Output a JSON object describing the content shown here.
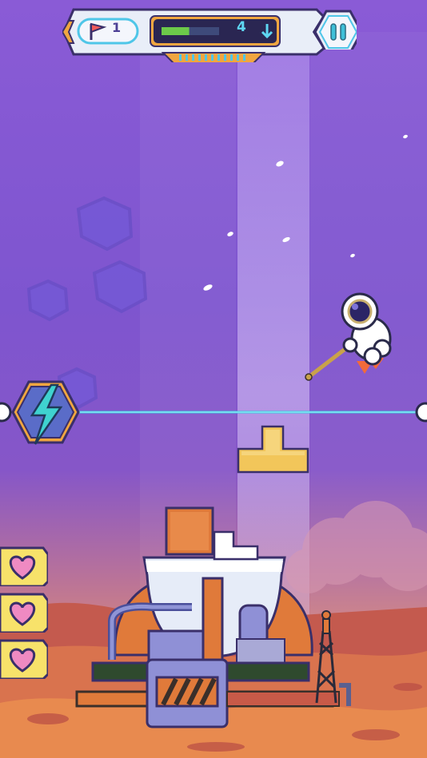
{
  "hud": {
    "flag_count": "1",
    "depth_count": "4",
    "progress": 0.48,
    "flag_icon": "flag-icon",
    "depth_icon": "arrow-down-icon",
    "pause_icon": "pause-icon"
  },
  "lives": {
    "count": 3,
    "icon": "heart-icon"
  },
  "power_icon": "lightning-bolt-icon",
  "colors": {
    "sky": "#7e55cf",
    "block_orange": "#e07a3a",
    "tpiece_yellow": "#f2c65a",
    "laser": "#34c8e0",
    "heart_pink": "#ef8ac2",
    "progress_green": "#6cc94a"
  }
}
